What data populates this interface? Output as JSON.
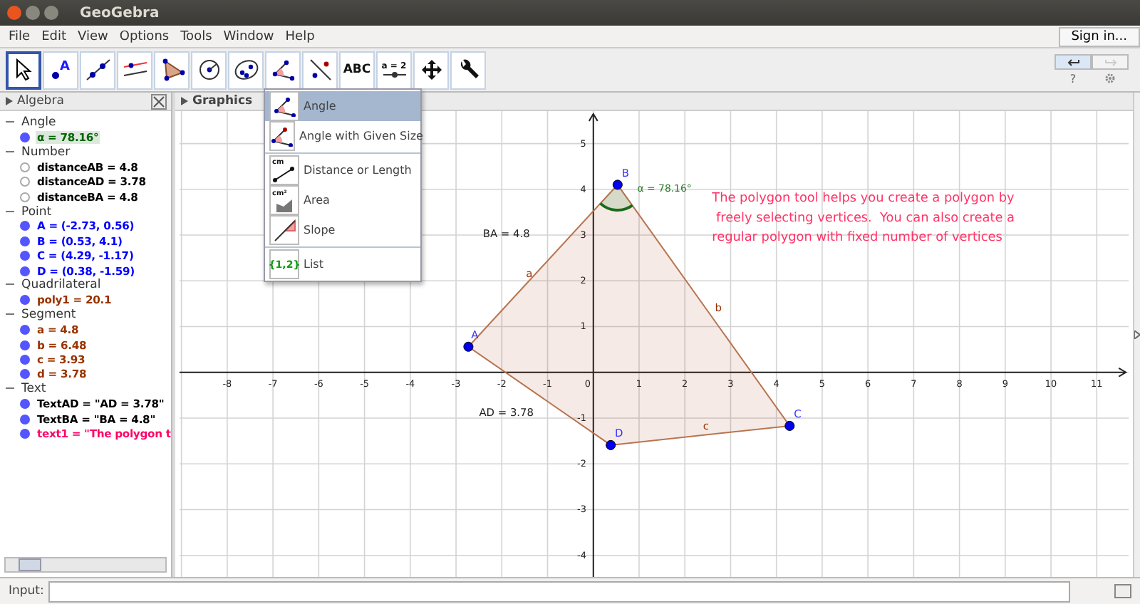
{
  "window": {
    "title": "GeoGebra"
  },
  "menu": [
    "File",
    "Edit",
    "View",
    "Options",
    "Tools",
    "Window",
    "Help"
  ],
  "sign_in": "Sign in...",
  "toolbar": {
    "tools": [
      {
        "kind": "move",
        "selected": true
      },
      {
        "kind": "point",
        "label": "A",
        "selected": false
      },
      {
        "kind": "line",
        "selected": false
      },
      {
        "kind": "perpendicular",
        "selected": false
      },
      {
        "kind": "polygon",
        "selected": false
      },
      {
        "kind": "circle",
        "selected": false
      },
      {
        "kind": "ellipse",
        "selected": false
      },
      {
        "kind": "angle",
        "selected": false
      },
      {
        "kind": "reflect",
        "selected": false
      },
      {
        "kind": "text",
        "label": "ABC",
        "selected": false
      },
      {
        "kind": "slider",
        "label": "a = 2",
        "selected": false
      },
      {
        "kind": "pan",
        "selected": false
      },
      {
        "kind": "wrench",
        "selected": false
      }
    ],
    "undo": {
      "disabled": false
    },
    "redo": {
      "disabled": true
    },
    "help": "?"
  },
  "algebra": {
    "title": "Algebra",
    "groups": [
      {
        "label": "Angle",
        "items": [
          {
            "text": "α = 78.16°",
            "color": "#006400",
            "shown": true,
            "selected": true
          }
        ]
      },
      {
        "label": "Number",
        "items": [
          {
            "text": "distanceAB = 4.8",
            "color": "#000000",
            "shown": false,
            "selected": false
          },
          {
            "text": "distanceAD = 3.78",
            "color": "#000000",
            "shown": false,
            "selected": false
          },
          {
            "text": "distanceBA = 4.8",
            "color": "#000000",
            "shown": false,
            "selected": false
          }
        ]
      },
      {
        "label": "Point",
        "items": [
          {
            "text": "A = (-2.73, 0.56)",
            "color": "#0000ff",
            "shown": true,
            "selected": false
          },
          {
            "text": "B = (0.53, 4.1)",
            "color": "#0000ff",
            "shown": true,
            "selected": false
          },
          {
            "text": "C = (4.29, -1.17)",
            "color": "#0000ff",
            "shown": true,
            "selected": false
          },
          {
            "text": "D = (0.38, -1.59)",
            "color": "#0000ff",
            "shown": true,
            "selected": false
          }
        ]
      },
      {
        "label": "Quadrilateral",
        "items": [
          {
            "text": "poly1 = 20.1",
            "color": "#993300",
            "shown": true,
            "selected": false
          }
        ]
      },
      {
        "label": "Segment",
        "items": [
          {
            "text": "a = 4.8",
            "color": "#993300",
            "shown": true,
            "selected": false
          },
          {
            "text": "b = 6.48",
            "color": "#993300",
            "shown": true,
            "selected": false
          },
          {
            "text": "c = 3.93",
            "color": "#993300",
            "shown": true,
            "selected": false
          },
          {
            "text": "d = 3.78",
            "color": "#993300",
            "shown": true,
            "selected": false
          }
        ]
      },
      {
        "label": "Text",
        "items": [
          {
            "text": "TextAD = \"AD = 3.78\"",
            "color": "#000000",
            "shown": true,
            "selected": false
          },
          {
            "text": "TextBA = \"BA = 4.8\"",
            "color": "#000000",
            "shown": true,
            "selected": false
          },
          {
            "text": "text1 = \"The polygon t",
            "color": "#ff0066",
            "shown": true,
            "selected": false
          }
        ]
      }
    ]
  },
  "graphics": {
    "title": "Graphics",
    "x_ticks": [
      "-8",
      "-7",
      "-6",
      "-5",
      "-4",
      "-3",
      "-2",
      "-1",
      "0",
      "1",
      "2",
      "3",
      "4",
      "5",
      "6",
      "7",
      "8",
      "9",
      "10",
      "11"
    ],
    "y_ticks": [
      "5",
      "4",
      "3",
      "2",
      "1",
      "-1",
      "-2",
      "-3",
      "-4"
    ],
    "points": [
      {
        "name": "A"
      },
      {
        "name": "B"
      },
      {
        "name": "C"
      },
      {
        "name": "D"
      }
    ],
    "segment_labels": [
      "a",
      "b",
      "c"
    ],
    "angle_label": "α = 78.16°",
    "texts": [
      "BA = 4.8",
      "AD = 3.78"
    ],
    "note": [
      "The polygon tool helps you create a polygon by",
      " freely selecting vertices.  You can also create a",
      "regular polygon with fixed number of vertices"
    ]
  },
  "tool_menu": [
    {
      "kind": "angle",
      "label": "Angle",
      "selected": true
    },
    {
      "kind": "angle_fixed",
      "label": "Angle with Given Size",
      "selected": false
    },
    {
      "kind": "distance",
      "icon_label": "cm",
      "label": "Distance or Length",
      "selected": false
    },
    {
      "kind": "area",
      "icon_label": "cm²",
      "label": "Area",
      "selected": false
    },
    {
      "kind": "slope",
      "label": "Slope",
      "selected": false
    },
    {
      "kind": "list",
      "icon_label": "{1,2}",
      "label": "List",
      "selected": false
    }
  ],
  "input_bar": {
    "label": "Input:"
  }
}
